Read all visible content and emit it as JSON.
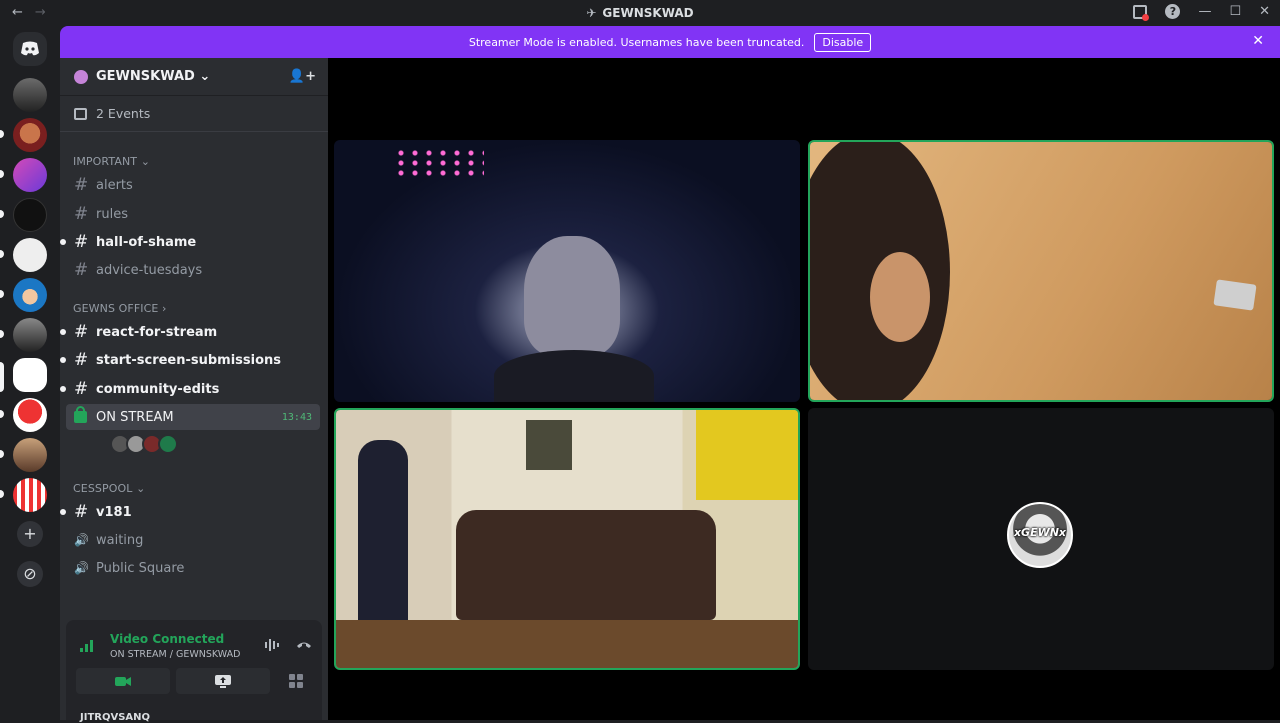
{
  "titlebar": {
    "back": "←",
    "forward": "→",
    "title": "GEWNSKWAD",
    "title_icon": "rocket-icon",
    "help": "?",
    "minimize": "—",
    "maximize": "☐",
    "close": "✕"
  },
  "banner": {
    "message": "Streamer Mode is enabled. Usernames have been truncated.",
    "disable_label": "Disable",
    "close": "✕",
    "color": "#8134f5"
  },
  "guilds": {
    "add": "+",
    "discover": "⊘"
  },
  "server": {
    "name": "GEWNSKWAD ⌄",
    "events": "2 Events",
    "invite": "👤+"
  },
  "categories": {
    "important": "IMPORTANT ⌄",
    "gewns_office": "GEWNS OFFICE ›",
    "cesspool": "CESSPOOL ⌄"
  },
  "channels": {
    "alerts": "alerts",
    "rules": "rules",
    "hall_of_shame": "hall-of-shame",
    "advice_tuesdays": "advice-tuesdays",
    "react_for_stream": "react-for-stream",
    "start_screen_submissions": "start-screen-submissions",
    "community_edits": "community-edits",
    "on_stream": "ON STREAM",
    "on_stream_time": "13:43",
    "v181": "v181",
    "waiting": "waiting",
    "public_square": "Public Square"
  },
  "voice_panel": {
    "status": "Video Connected",
    "location": "ON STREAM / GEWNSKWAD",
    "status_color": "#23a55a"
  },
  "user_strip": "JITRQVSANQ",
  "tiles": {
    "offline_user": "xGEWNx"
  }
}
